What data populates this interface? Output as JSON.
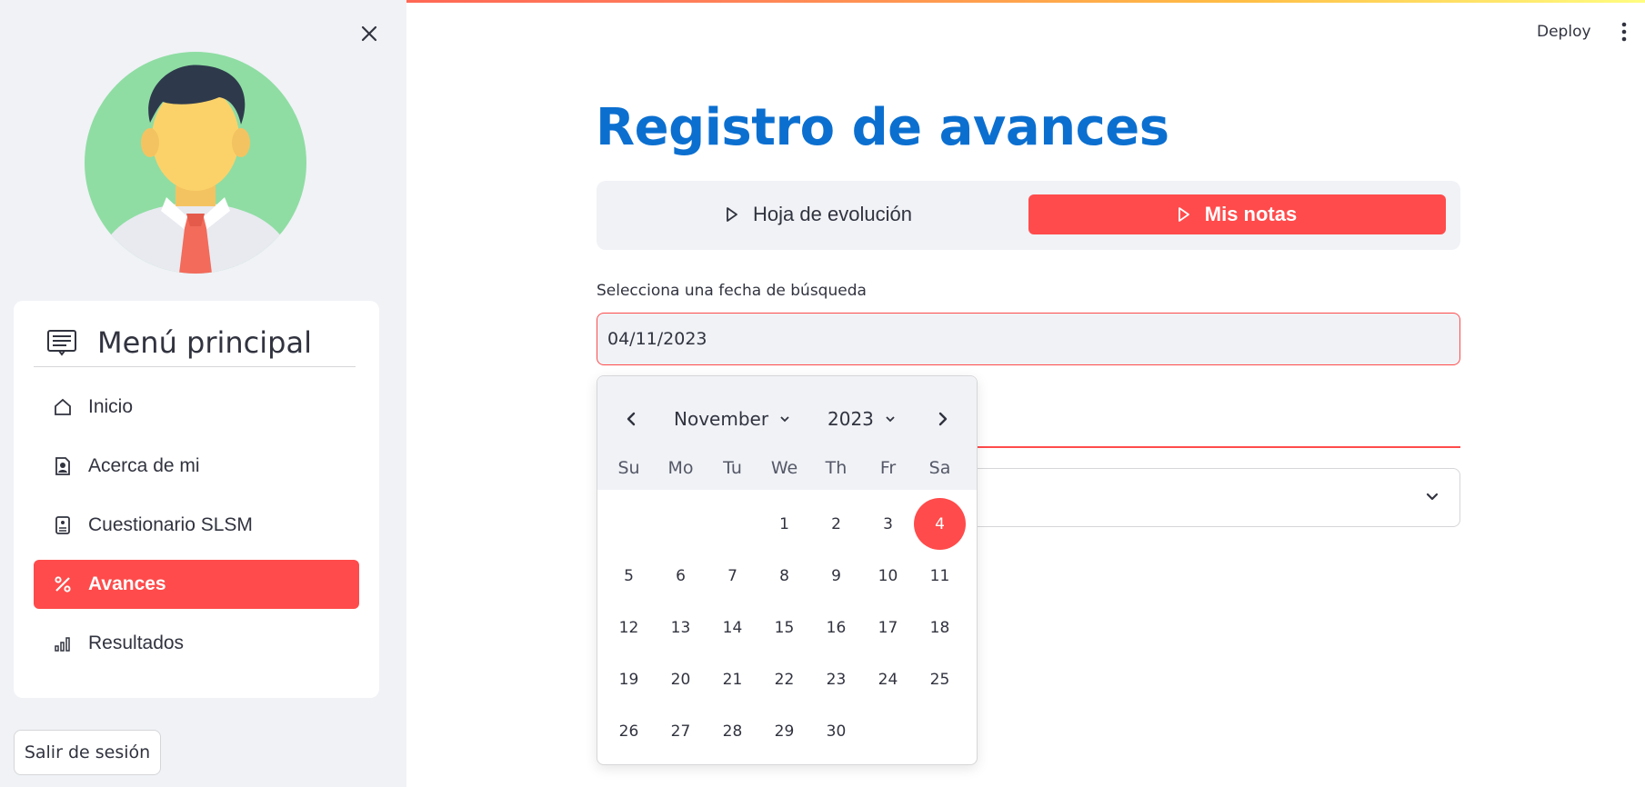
{
  "header": {
    "deploy_label": "Deploy"
  },
  "sidebar": {
    "menu_title": "Menú principal",
    "items": [
      {
        "label": "Inicio",
        "icon": "house-icon",
        "active": false
      },
      {
        "label": "Acerca de mi",
        "icon": "person-badge-icon",
        "active": false
      },
      {
        "label": "Cuestionario SLSM",
        "icon": "clipboard-icon",
        "active": false
      },
      {
        "label": "Avances",
        "icon": "percent-icon",
        "active": true
      },
      {
        "label": "Resultados",
        "icon": "bar-chart-icon",
        "active": false
      }
    ],
    "logout_label": "Salir de sesión"
  },
  "main": {
    "title": "Registro de avances",
    "tabs": [
      {
        "label": "Hoja de evolución",
        "active": false
      },
      {
        "label": "Mis notas",
        "active": true
      }
    ],
    "date_label": "Selecciona una fecha de búsqueda",
    "date_value": "04/11/2023"
  },
  "calendar": {
    "month": "November",
    "year": "2023",
    "weekdays": [
      "Su",
      "Mo",
      "Tu",
      "We",
      "Th",
      "Fr",
      "Sa"
    ],
    "days": [
      "1",
      "2",
      "3",
      "4",
      "5",
      "6",
      "7",
      "8",
      "9",
      "10",
      "11",
      "12",
      "13",
      "14",
      "15",
      "16",
      "17",
      "18",
      "19",
      "20",
      "21",
      "22",
      "23",
      "24",
      "25",
      "26",
      "27",
      "28",
      "29",
      "30"
    ],
    "first_weekday_index": 3,
    "selected_day": "4"
  },
  "colors": {
    "accent": "#ff4b4b",
    "title_blue": "#0b6fd0",
    "sidebar_bg": "#f0f2f6"
  }
}
